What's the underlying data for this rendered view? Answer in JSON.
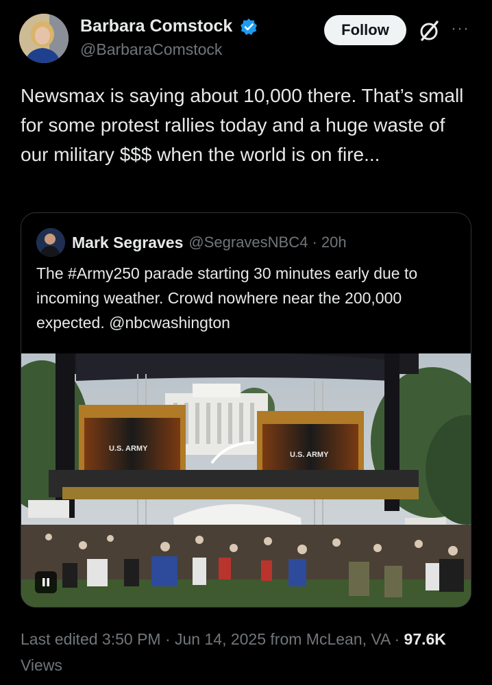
{
  "author": {
    "display_name": "Barbara Comstock",
    "handle": "@BarbaraComstock",
    "avatar_icon": "profile-photo",
    "verified_icon": "verified-badge-icon",
    "verified_color": "#1d9bf0"
  },
  "actions": {
    "follow_label": "Follow",
    "grok_icon": "grok-icon",
    "more_icon": "more-options-icon",
    "more_glyph": "···"
  },
  "post": {
    "text": "Newsmax is saying about 10,000 there. That’s small for some protest rallies today and a huge waste of our military $$$ when the world is on fire..."
  },
  "quoted_post": {
    "display_name": "Mark Segraves",
    "handle_time": "@SegravesNBC4 · 20h",
    "text": "The #Army250 parade starting 30 minutes early due to incoming weather. Crowd nowhere near the 200,000 expected. @nbcwashington",
    "media": {
      "type": "video",
      "screen_left_label": "U.S. ARMY",
      "screen_right_label": "U.S. ARMY",
      "playback_icon": "pause-icon"
    }
  },
  "meta": {
    "edited": "Last edited 3:50 PM · Jun 14, 2025 from McLean, VA · ",
    "views_count": "97.6K",
    "views_label": " Views"
  },
  "colors": {
    "background": "#000000",
    "text_primary": "#e7e9ea",
    "text_secondary": "#71767b",
    "border": "#2f3336"
  }
}
